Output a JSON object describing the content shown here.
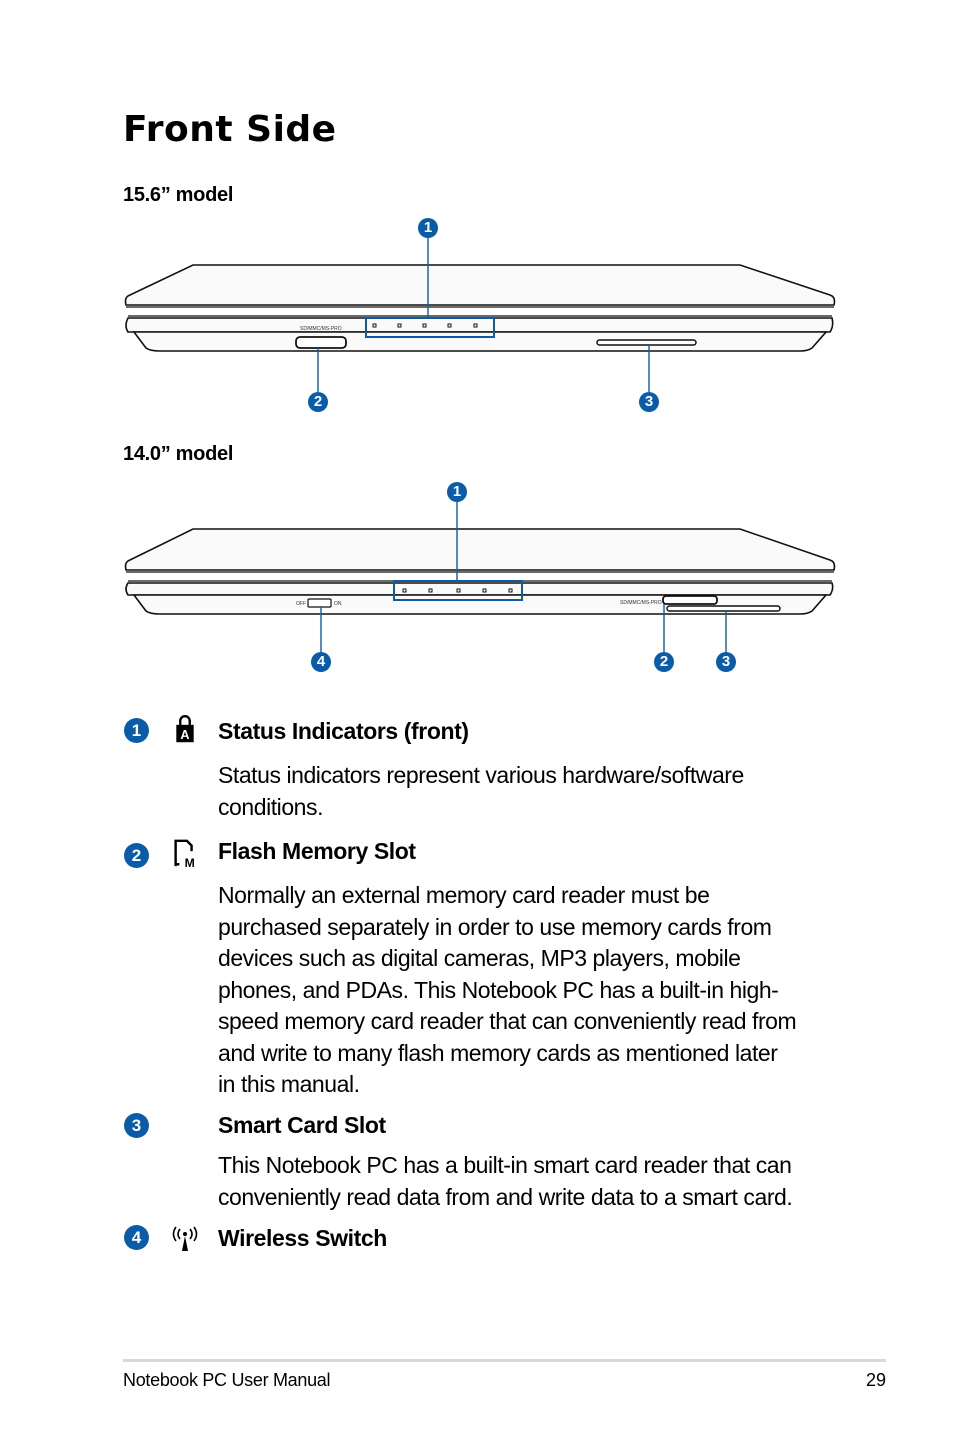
{
  "page": {
    "title": "Front Side",
    "accent_color": "#0b5ca8"
  },
  "models": [
    {
      "label": "15.6” model",
      "card_reader_label": "SD/MMC/MS-PRO",
      "status_led_count": 5,
      "callouts": [
        "1",
        "2",
        "3"
      ]
    },
    {
      "label": "14.0” model",
      "card_reader_label": "SD/MMC/MS-PRO",
      "switch_off_label": "OFF",
      "switch_on_label": "ON",
      "status_led_count": 5,
      "callouts": [
        "1",
        "4",
        "2",
        "3"
      ]
    }
  ],
  "items": [
    {
      "number": "1",
      "icon": "lock-a-icon",
      "title": "Status Indicators (front)",
      "description": [
        "Status indicators represent various hardware/software",
        "conditions."
      ]
    },
    {
      "number": "2",
      "icon": "memory-card-icon",
      "title": "Flash Memory Slot",
      "description": [
        "Normally an external memory card reader must be",
        "purchased separately in order to use memory cards from",
        "devices such as digital cameras, MP3 players, mobile",
        "phones, and PDAs. This Notebook PC has a built-in high-",
        "speed memory card reader that can conveniently read from",
        "and write to many flash memory cards as mentioned later",
        "in this manual."
      ]
    },
    {
      "number": "3",
      "icon": "",
      "title": "Smart Card Slot",
      "description": [
        "This Notebook PC has a built-in smart card reader that can",
        "conveniently read data from and write data to a smart card."
      ]
    },
    {
      "number": "4",
      "icon": "wireless-icon",
      "title": "Wireless Switch",
      "description": []
    }
  ],
  "footer": {
    "manual_title": "Notebook PC User Manual",
    "page_number": "29"
  }
}
